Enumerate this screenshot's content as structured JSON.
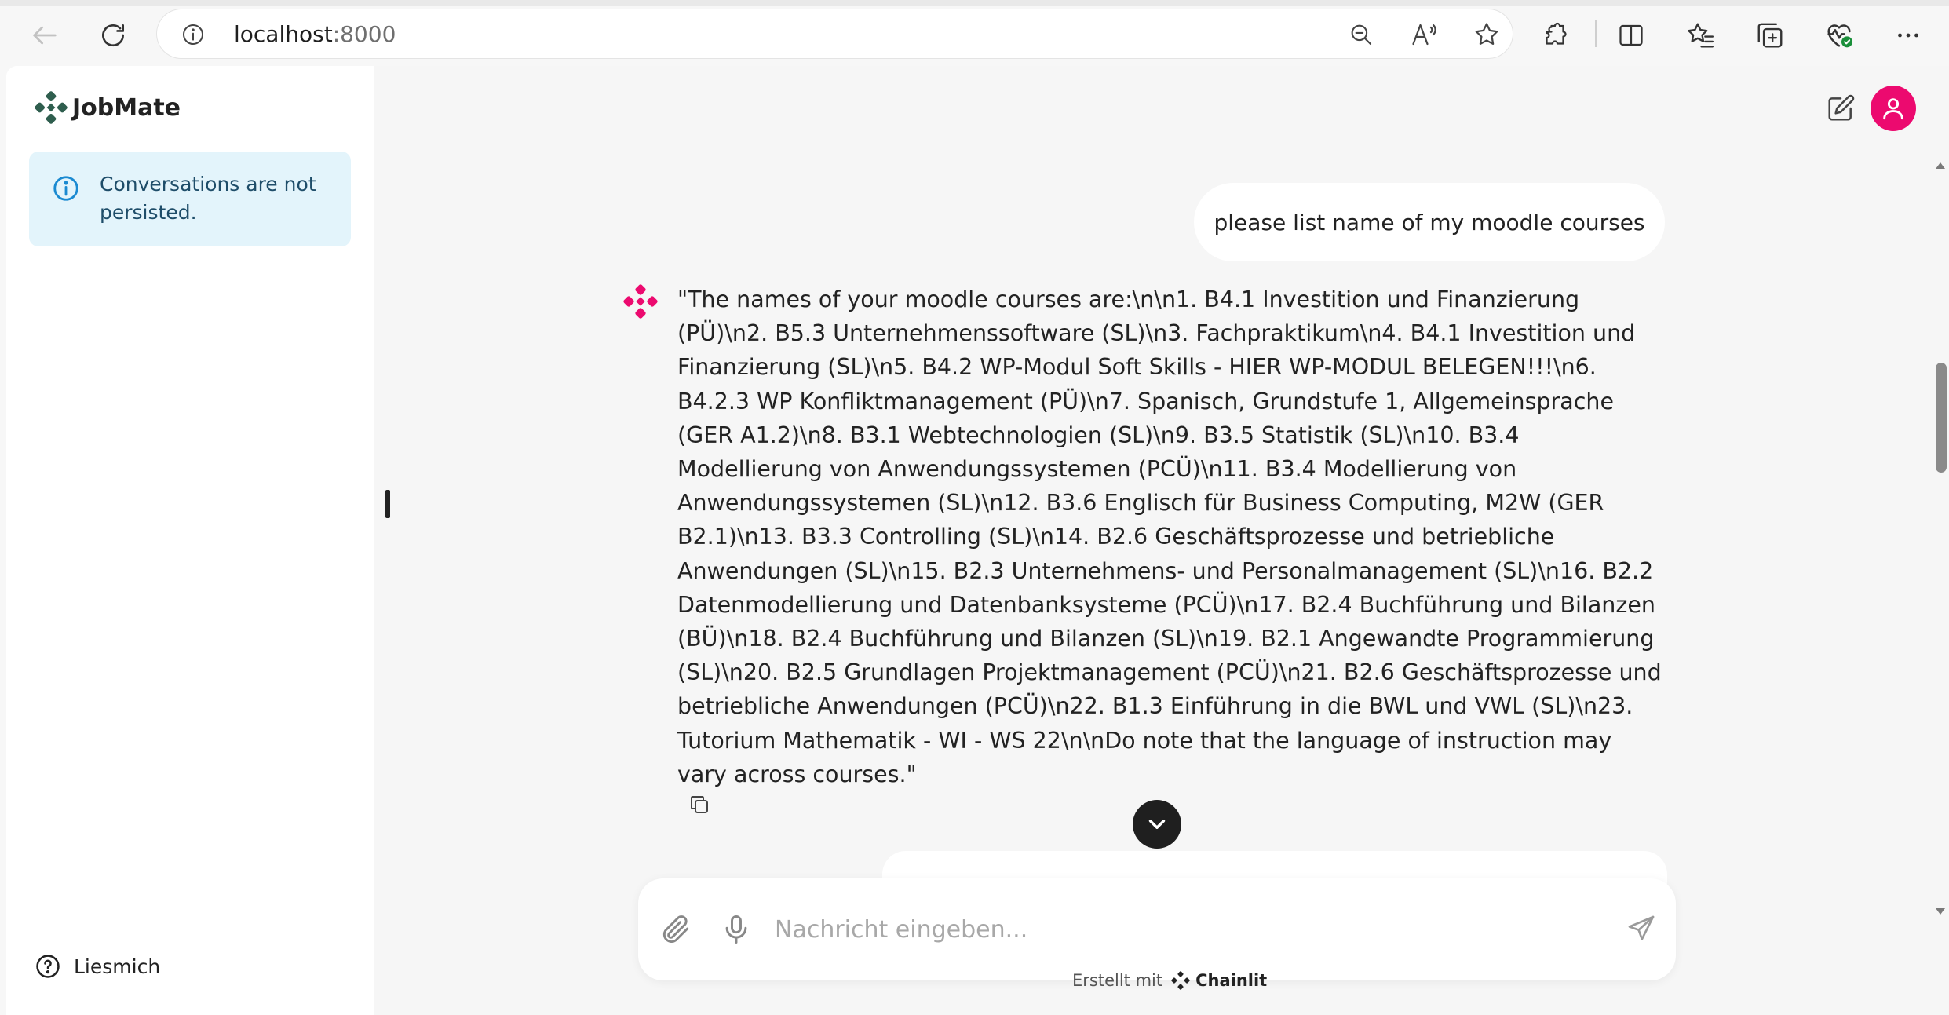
{
  "browser": {
    "url_host": "localhost",
    "url_port": ":8000"
  },
  "sidebar": {
    "app_name": "JobMate",
    "notice": "Conversations are not persisted.",
    "readme_label": "Liesmich"
  },
  "chat": {
    "user_message": "please list name of my moodle courses",
    "bot_message": "\"The names of your moodle courses are:\\n\\n1. B4.1 Investition und Finanzierung (PÜ)\\n2. B5.3 Unternehmenssoftware (SL)\\n3. Fachpraktikum\\n4. B4.1 Investition und Finanzierung (SL)\\n5. B4.2 WP-Modul Soft Skills - HIER WP-MODUL BELEGEN!!!\\n6. B4.2.3 WP Konfliktmanagement (PÜ)\\n7. Spanisch, Grundstufe 1, Allgemeinsprache (GER A1.2)\\n8. B3.1 Webtechnologien (SL)\\n9. B3.5 Statistik (SL)\\n10. B3.4 Modellierung von Anwendungssystemen (PCÜ)\\n11. B3.4 Modellierung von Anwendungssystemen (SL)\\n12. B3.6 Englisch für Business Computing, M2W (GER B2.1)\\n13. B3.3 Controlling (SL)\\n14. B2.6 Geschäftsprozesse und betriebliche Anwendungen (SL)\\n15. B2.3 Unternehmens- und Personalmanagement (SL)\\n16. B2.2 Datenmodellierung und Datenbanksysteme (PCÜ)\\n17. B2.4 Buchführung und Bilanzen (BÜ)\\n18. B2.4 Buchführung und Bilanzen (SL)\\n19. B2.1 Angewandte Programmierung (SL)\\n20. B2.5 Grundlagen Projektmanagement (PCÜ)\\n21. B2.6 Geschäftsprozesse und betriebliche Anwendungen (PCÜ)\\n22. B1.3 Einführung in die BWL und VWL (SL)\\n23. Tutorium Mathematik - WI - WS 22\\n\\nDo note that the language of instruction may vary across courses.\""
  },
  "composer": {
    "placeholder": "Nachricht eingeben..."
  },
  "footer": {
    "prefix": "Erstellt mit",
    "brand": "Chainlit"
  },
  "colors": {
    "accent": "#ec0a6f",
    "notice_bg": "#e3f4fb",
    "notice_text": "#1e4d69",
    "logo_green": "#2f5e4e"
  },
  "icons": {
    "back": "arrow-left-icon",
    "reload": "reload-icon",
    "site_info": "info-icon",
    "zoom": "zoom-out-icon",
    "read_aloud": "read-aloud-icon",
    "favorite": "star-icon",
    "extensions": "puzzle-icon",
    "split": "split-screen-icon",
    "favorites": "favorites-icon",
    "collections": "collections-icon",
    "health": "heart-pulse-icon",
    "more": "more-icon"
  }
}
